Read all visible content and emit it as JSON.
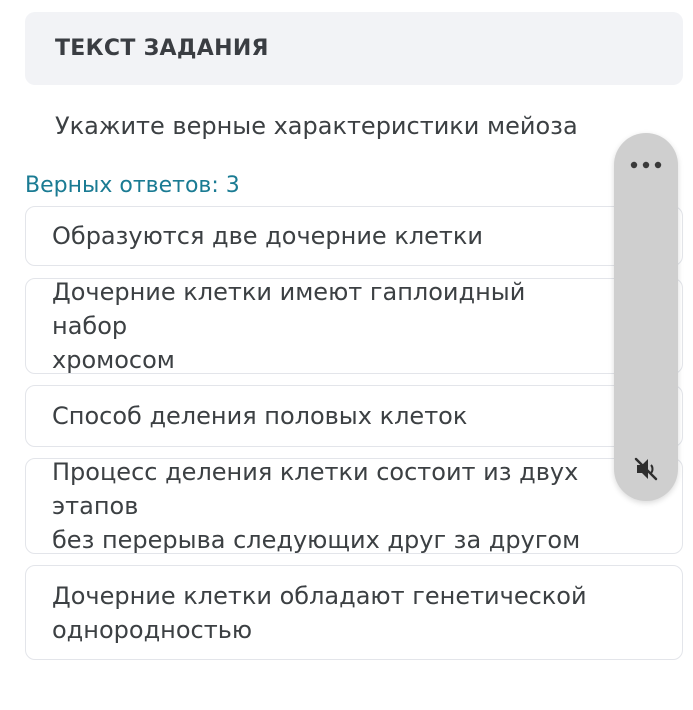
{
  "task": {
    "header": "ТЕКСТ ЗАДАНИЯ",
    "question": "Укажите верные характеристики мейоза",
    "correct_count": "Верных ответов: 3"
  },
  "options": [
    {
      "line1": "Образуются две дочерние клетки",
      "line2": ""
    },
    {
      "line1": "Дочерние клетки имеют гаплоидный набор",
      "line2": "хромосом"
    },
    {
      "line1": "Способ деления половых клеток",
      "line2": ""
    },
    {
      "line1": "Процесс деления клетки состоит из двух этапов",
      "line2": "без перерыва следующих друг за другом"
    },
    {
      "line1": "Дочерние клетки обладают генетической",
      "line2": "однородностью"
    }
  ],
  "floating_controls": {
    "more_icon": "more-horizontal-icon",
    "mute_icon": "speaker-muted-icon"
  },
  "colors": {
    "header_bg": "#f2f3f6",
    "accent": "#1a7b93",
    "text": "#3c4043",
    "border": "#e3e5ea",
    "pill_bg": "#cfcfcf"
  }
}
